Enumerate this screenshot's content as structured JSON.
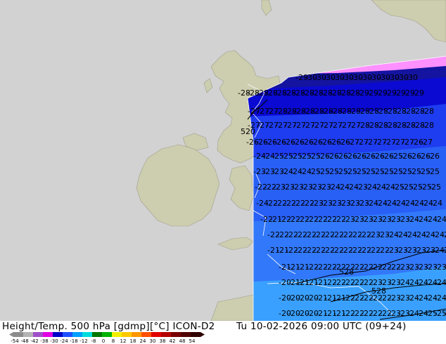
{
  "header": {
    "title": "Height/Temp. 500 hPa [gdmp][°C] ICON-D2",
    "valid_time": "Tu 10-02-2026 09:00 UTC (09+24)"
  },
  "colorbar": {
    "ticks": [
      "-54",
      "-48",
      "-42",
      "-38",
      "-30",
      "-24",
      "-18",
      "-12",
      "-8",
      "0",
      "8",
      "12",
      "18",
      "24",
      "30",
      "38",
      "42",
      "48",
      "54"
    ],
    "colors": [
      "#8c8c8c",
      "#b4b4b4",
      "#a050c8",
      "#e100e1",
      "#0000c8",
      "#1e50ff",
      "#00a0ff",
      "#00dcdc",
      "#007800",
      "#00b400",
      "#f0f000",
      "#ffc800",
      "#ff9600",
      "#ff5000",
      "#e10000",
      "#b40000",
      "#780000",
      "#500000",
      "#300000"
    ]
  },
  "map": {
    "colors": {
      "sea": "#d2d2d2",
      "land": "#cdcdaf",
      "temp_bands": [
        "#ff90ff",
        "#1414a0",
        "#0a0ad2",
        "#1e3cf0",
        "#285ff5",
        "#3278fa",
        "#3a8cff"
      ]
    },
    "height_contour_labels": [
      "520",
      "528",
      "528"
    ],
    "temperature_labels": [
      "-30",
      "-29",
      "-28",
      "-27",
      "-26",
      "-25",
      "-24",
      "-23",
      "-22",
      "-21",
      "-20"
    ]
  }
}
